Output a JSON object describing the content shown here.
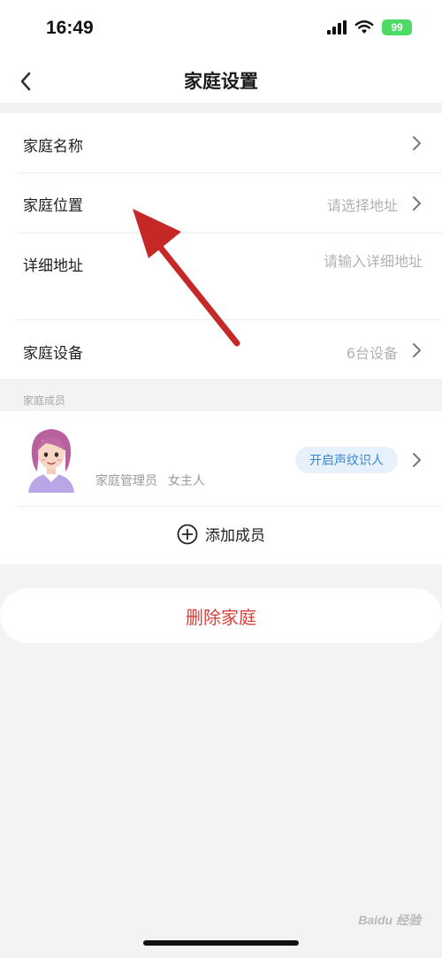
{
  "status_bar": {
    "time": "16:49",
    "battery": "99"
  },
  "nav": {
    "title": "家庭设置"
  },
  "settings": {
    "family_name_label": "家庭名称",
    "family_location_label": "家庭位置",
    "family_location_placeholder": "请选择地址",
    "detail_address_label": "详细地址",
    "detail_address_placeholder": "请输入详细地址",
    "family_devices_label": "家庭设备",
    "family_devices_value": "6台设备"
  },
  "members": {
    "section_label": "家庭成员",
    "member": {
      "role": "家庭管理员",
      "nickname": "女主人",
      "voice_button": "开启声纹识人"
    },
    "add_member_label": "添加成员"
  },
  "delete_family_label": "删除家庭",
  "watermark": "Baidu 经验",
  "colors": {
    "accent_blue": "#3a86cf",
    "danger_red": "#d7403b",
    "annotation_arrow": "#c62828"
  }
}
